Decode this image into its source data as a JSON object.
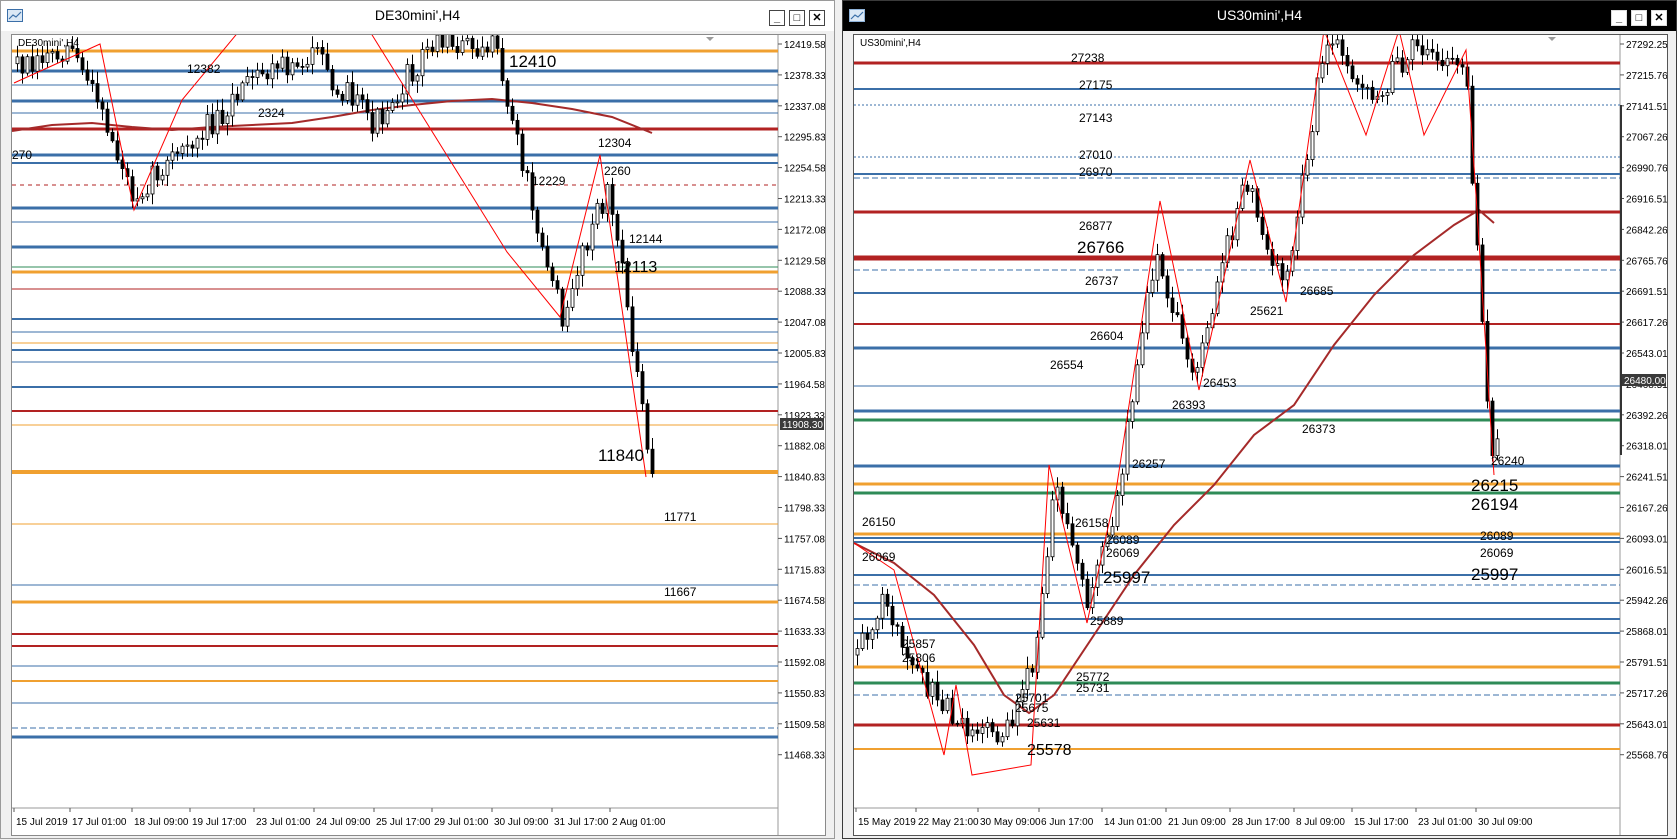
{
  "windows": [
    {
      "title": "DE30mini',H4",
      "symbol_label": "DE30mini',H4",
      "plot_bg": "#ffffff",
      "price_axis": {
        "ticks": [
          "12419.58",
          "12378.33",
          "12337.08",
          "12295.83",
          "12254.58",
          "12213.33",
          "12172.08",
          "12129.58",
          "12088.33",
          "12047.08",
          "12005.83",
          "11964.58",
          "11923.33",
          "11882.08",
          "11840.83",
          "11798.33",
          "11757.08",
          "11715.83",
          "11674.58",
          "11633.33",
          "11592.08",
          "11550.83",
          "11509.58",
          "11468.33"
        ],
        "current_price": "11908.30"
      },
      "time_axis": [
        "15 Jul 2019",
        "17 Jul 01:00",
        "18 Jul 09:00",
        "19 Jul 17:00",
        "23 Jul 01:00",
        "24 Jul 09:00",
        "25 Jul 17:00",
        "29 Jul 01:00",
        "30 Jul 09:00",
        "31 Jul 17:00",
        "2 Aug 01:00"
      ],
      "annotations": [
        "270",
        "12382",
        "2324",
        "12410",
        "12304",
        "2260",
        "12229",
        "12144",
        "12113",
        "11840",
        "11771",
        "11667"
      ],
      "colors": {
        "bull": "#ffffff",
        "bear": "#000000",
        "zigzag": "#ff0000",
        "ma": "#a52a2a",
        "level_blue": "#3b6fa8",
        "level_orange": "#f0a030",
        "level_red": "#b22222",
        "level_green": "#2e8b57"
      }
    },
    {
      "title": "US30mini',H4",
      "symbol_label": "US30mini',H4",
      "plot_bg": "#ffffff",
      "price_axis": {
        "ticks": [
          "27292.25",
          "27215.76",
          "27141.51",
          "27067.26",
          "26990.76",
          "26916.51",
          "26842.26",
          "26765.76",
          "26691.51",
          "26617.26",
          "26543.01",
          "26468.51",
          "26392.26",
          "26318.01",
          "26241.51",
          "26167.26",
          "26093.01",
          "26016.51",
          "25942.26",
          "25868.01",
          "25791.51",
          "25717.26",
          "25643.01",
          "25568.76"
        ],
        "current_price": "26480.00"
      },
      "time_axis": [
        "15 May 2019",
        "22 May 21:00",
        "30 May 09:00",
        "6 Jun 17:00",
        "14 Jun 01:00",
        "21 Jun 09:00",
        "28 Jun 17:00",
        "8 Jul 09:00",
        "15 Jul 17:00",
        "23 Jul 01:00",
        "30 Jul 09:00"
      ],
      "annotations": [
        "27238",
        "27175",
        "27143",
        "27010",
        "26970",
        "26877",
        "26766",
        "26737",
        "26685",
        "25621",
        "26604",
        "26554",
        "26453",
        "26393",
        "26373",
        "26257",
        "26240",
        "26215",
        "26194",
        "26150",
        "26069",
        "26158",
        "26089",
        "26069",
        "26089",
        "26069",
        "25997",
        "25997",
        "25889",
        "25857",
        "25806",
        "25772",
        "25731",
        "25701",
        "25675",
        "25631",
        "25578"
      ],
      "colors": {
        "bull": "#ffffff",
        "bear": "#000000",
        "zigzag": "#ff0000",
        "ma": "#a52a2a",
        "level_blue": "#3b6fa8",
        "level_orange": "#f0a030",
        "level_red": "#b22222",
        "level_green": "#2e8b57"
      }
    }
  ],
  "controls": {
    "minimize": "_",
    "maximize": "□",
    "close": "✕"
  }
}
